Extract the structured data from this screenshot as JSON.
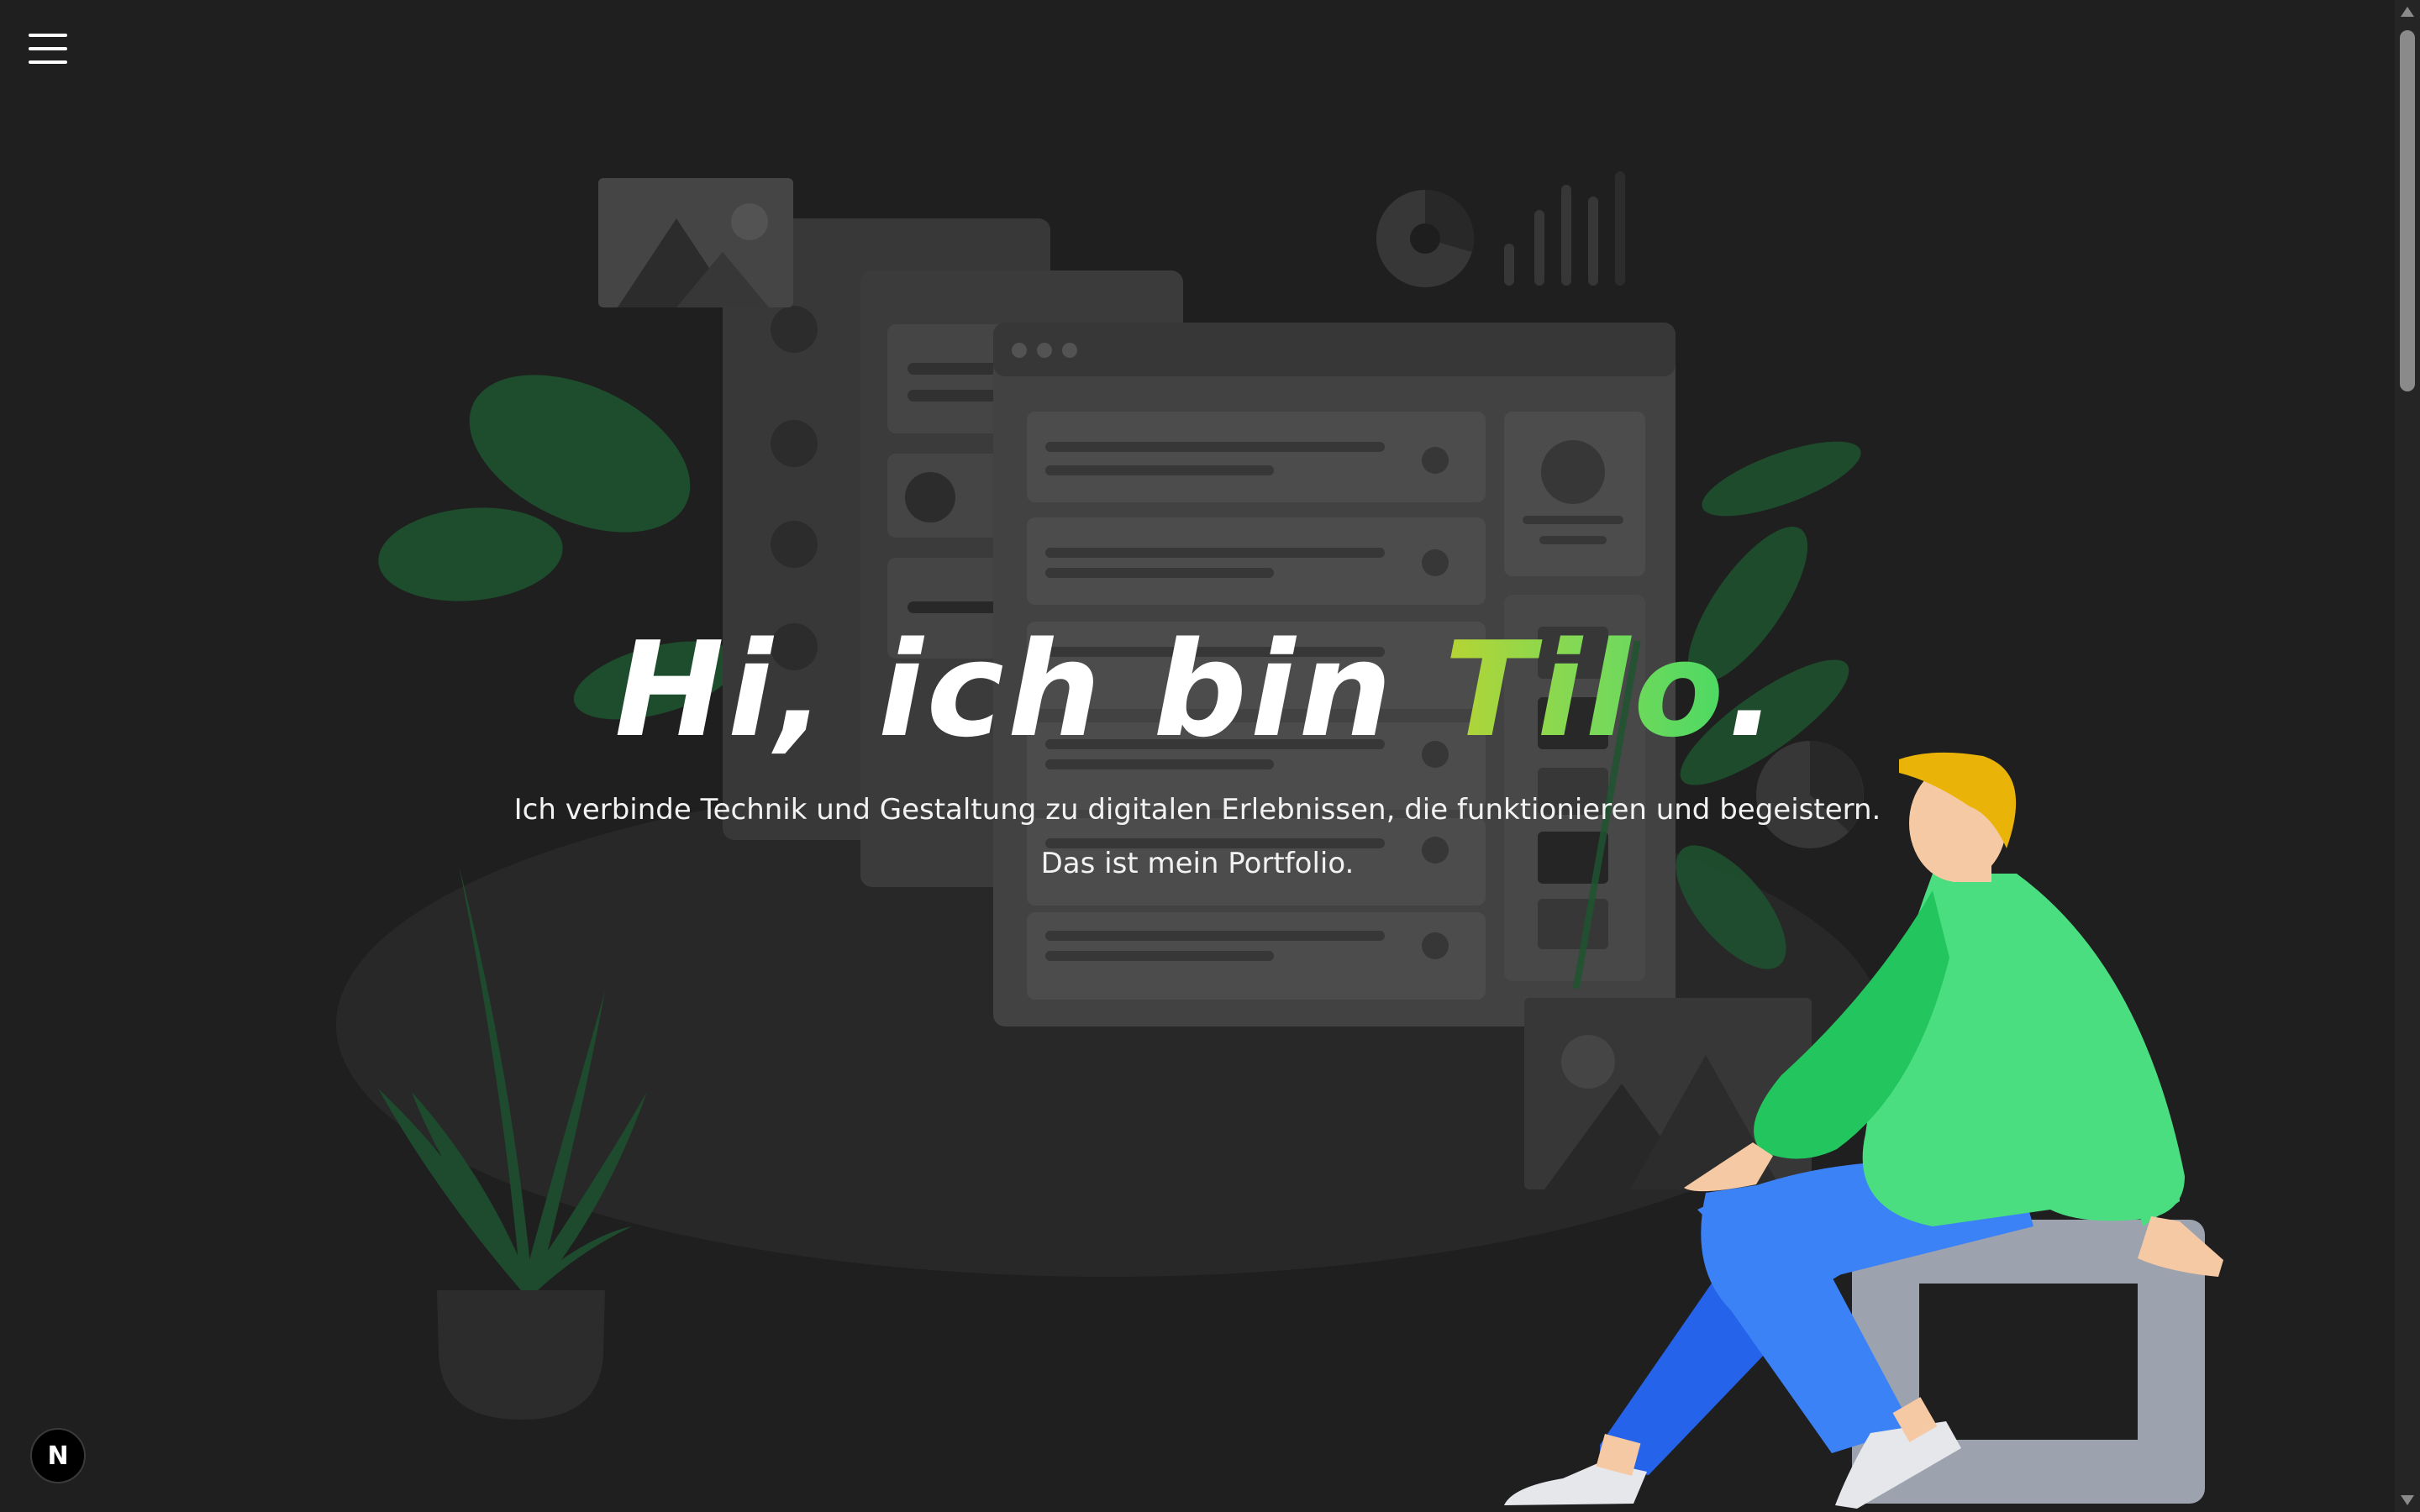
{
  "nav": {
    "menu_icon": "hamburger-menu-icon"
  },
  "hero": {
    "title_prefix": "Hi, ich bin ",
    "title_name": "Tilo",
    "title_suffix": ".",
    "tagline_line1": "Ich verbinde Technik und Gestaltung zu digitalen Erlebnissen, die funktionieren und begeistern.",
    "tagline_line2": "Das ist mein Portfolio."
  },
  "dev_badge": {
    "label": "N",
    "icon": "nextjs-badge-icon"
  },
  "colors": {
    "background": "#1f1f1f",
    "accent_gradient_start": "#b7d433",
    "accent_gradient_end": "#4cd964",
    "shirt": "#4ade80",
    "pants": "#3b82f6",
    "hair": "#eab308"
  }
}
